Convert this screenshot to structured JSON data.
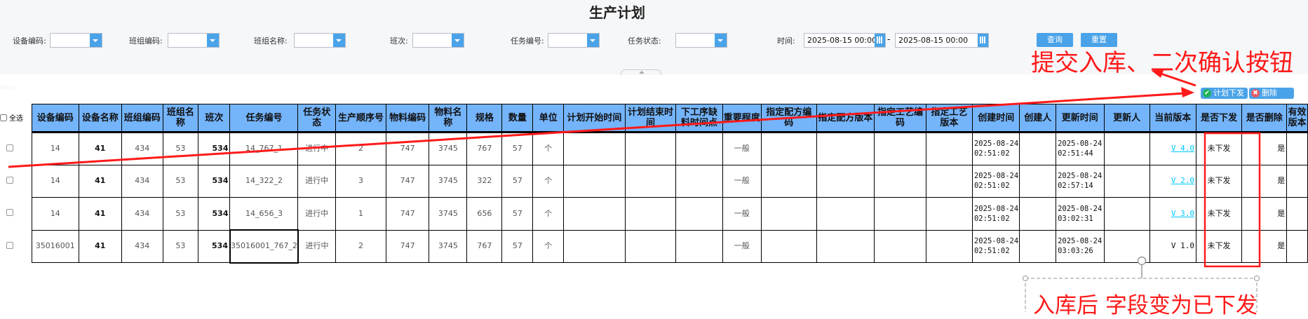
{
  "title": "生产计划",
  "filters": {
    "device_code": "设备编码:",
    "team_code": "班组编码:",
    "team_name": "班组名称:",
    "shift": "班次:",
    "task_no": "任务编号:",
    "task_status": "任务状态:",
    "time": "时间:",
    "time_from": "2025-08-15 00:00",
    "time_to": "2025-08-15 00:00",
    "dash": "-",
    "query": "查询",
    "reset": "重置"
  },
  "faint_text": "false",
  "toolbar": {
    "issue": "计划下发",
    "delete": "删除"
  },
  "select_all": "全选",
  "columns": [
    "设备编码",
    "设备名称",
    "班组编码",
    "班组名称",
    "班次",
    "任务编号",
    "任务状态",
    "生产顺序号",
    "物料编码",
    "物料名称",
    "规格",
    "数量",
    "单位",
    "计划开始时间",
    "计划结束时间",
    "下工序缺料时间点",
    "重要程度",
    "指定配方编码",
    "指定配方版本",
    "指定工艺编码",
    "指定工艺版本",
    "创建时间",
    "创建人",
    "更新时间",
    "更新人",
    "当前版本",
    "是否下发",
    "是否删除",
    "有效版本"
  ],
  "rows": [
    [
      "14",
      "41",
      "434",
      "53",
      "534",
      "14_767_1",
      "进行中",
      "2",
      "747",
      "3745",
      "767",
      "57",
      "个",
      "",
      "",
      "",
      "一般",
      "",
      "",
      "",
      "",
      "2025-08-24 02:51:02",
      "",
      "2025-08-24 02:51:44",
      "",
      "V 4.0",
      "未下发",
      "是",
      ""
    ],
    [
      "14",
      "41",
      "434",
      "53",
      "534",
      "14_322_2",
      "进行中",
      "3",
      "747",
      "3745",
      "322",
      "57",
      "个",
      "",
      "",
      "",
      "一般",
      "",
      "",
      "",
      "",
      "2025-08-24 02:51:02",
      "",
      "2025-08-24 02:57:14",
      "",
      "V 2.0",
      "未下发",
      "是",
      ""
    ],
    [
      "14",
      "41",
      "434",
      "53",
      "534",
      "14_656_3",
      "进行中",
      "1",
      "747",
      "3745",
      "656",
      "57",
      "个",
      "",
      "",
      "",
      "一般",
      "",
      "",
      "",
      "",
      "2025-08-24 02:51:02",
      "",
      "2025-08-24 03:02:31",
      "",
      "V 3.0",
      "未下发",
      "是",
      ""
    ],
    [
      "35016001",
      "41",
      "434",
      "53",
      "534",
      "35016001_767_2",
      "进行中",
      "2",
      "747",
      "3745",
      "767",
      "57",
      "个",
      "",
      "",
      "",
      "一般",
      "",
      "",
      "",
      "",
      "2025-08-24 02:51:02",
      "",
      "2025-08-24 03:03:26",
      "",
      "V 1.0",
      "未下发",
      "是",
      ""
    ]
  ],
  "version_links": [
    true,
    true,
    true,
    false
  ],
  "annotations": {
    "top": "提交入库、二次确认按钮",
    "bottom": "入库后 字段变为已下发",
    "color": "#ff1a1a"
  },
  "colors": {
    "header": "#74b4fb",
    "button": "#4aa3e8"
  }
}
